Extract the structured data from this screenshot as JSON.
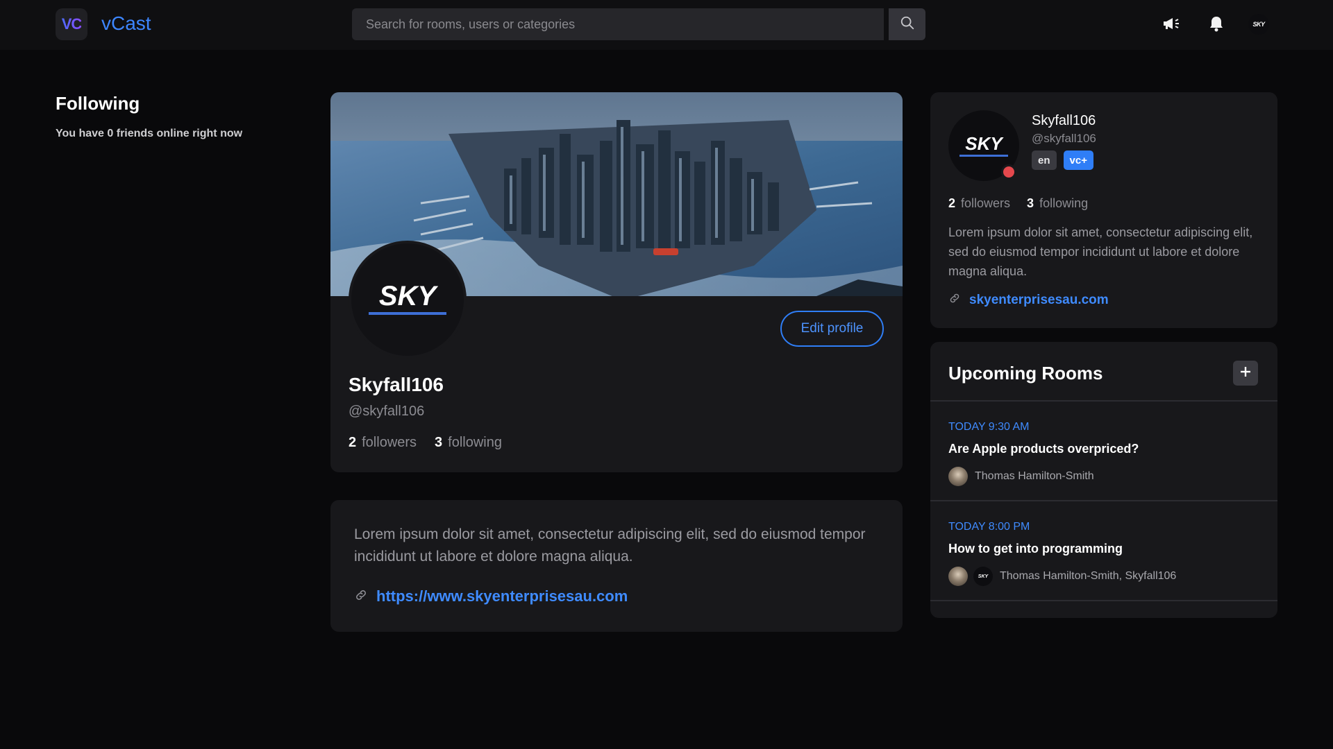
{
  "header": {
    "logo_text": "VC",
    "app_name": "vCast",
    "search_placeholder": "Search for rooms, users or categories",
    "icons": [
      "search-icon",
      "megaphone-icon",
      "bell-icon"
    ],
    "avatar_logo": "SKY"
  },
  "following": {
    "title": "Following",
    "subtitle": "You have 0 friends online right now"
  },
  "profile": {
    "avatar_logo": "SKY",
    "edit_label": "Edit profile",
    "name": "Skyfall106",
    "handle": "@skyfall106",
    "followers_count": "2",
    "followers_label": "followers",
    "following_count": "3",
    "following_label": "following"
  },
  "bio": {
    "text": "Lorem ipsum dolor sit amet, consectetur adipiscing elit, sed do eiusmod tempor incididunt ut labore et dolore magna aliqua.",
    "link": "https://www.skyenterprisesau.com"
  },
  "side_profile": {
    "avatar_logo": "SKY",
    "name": "Skyfall106",
    "handle": "@skyfall106",
    "tags": [
      "en",
      "vc+"
    ],
    "followers_count": "2",
    "followers_label": "followers",
    "following_count": "3",
    "following_label": "following",
    "bio": "Lorem ipsum dolor sit amet, consectetur adipiscing elit, sed do eiusmod tempor incididunt ut labore et dolore magna aliqua.",
    "link": "skyenterprisesau.com",
    "status_color": "#e5484d"
  },
  "upcoming": {
    "title": "Upcoming Rooms",
    "rooms": [
      {
        "time": "TODAY 9:30 AM",
        "title": "Are Apple products overpriced?",
        "hosts": "Thomas Hamilton-Smith"
      },
      {
        "time": "TODAY 8:00 PM",
        "title": "How to get into programming",
        "hosts": "Thomas Hamilton-Smith, Skyfall106"
      }
    ]
  },
  "colors": {
    "accent": "#3f8bff",
    "background": "#09090b",
    "card": "#18181b"
  }
}
